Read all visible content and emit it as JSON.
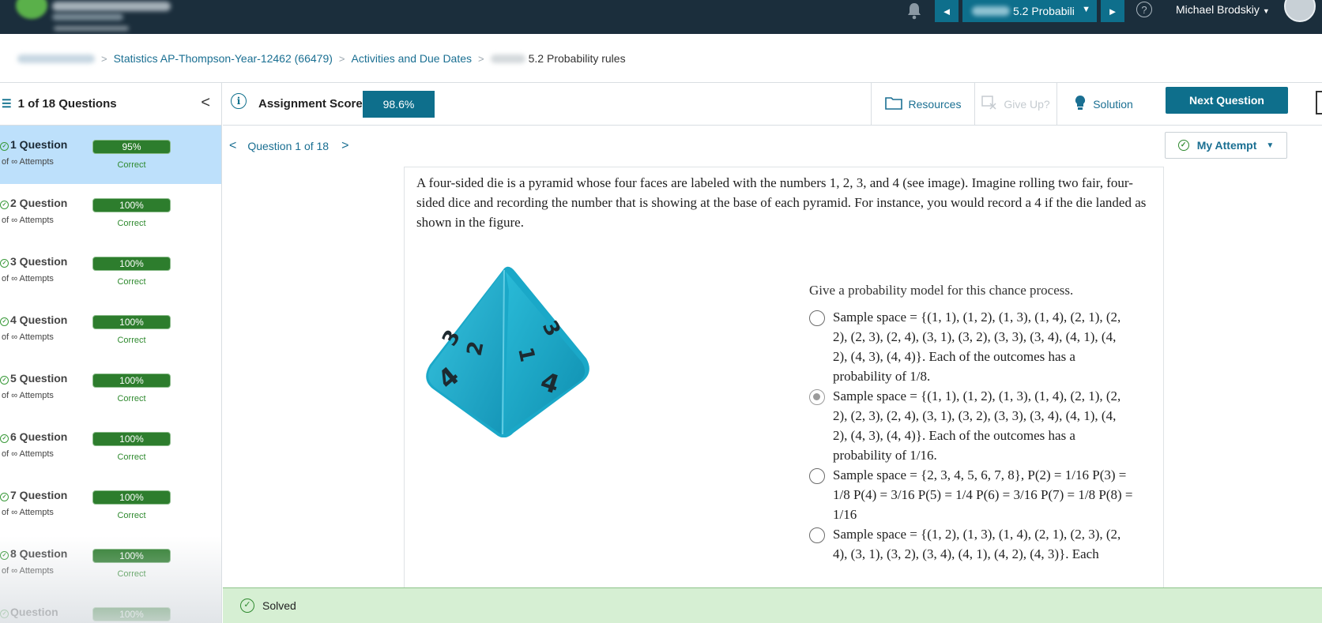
{
  "topbar": {
    "assignment_select": "5.2 Probabili",
    "prev_arrow": "◄",
    "next_arrow": "►",
    "select_caret": "▼",
    "help_label": "?",
    "user_name": "Michael Brodskiy",
    "user_caret": "▼"
  },
  "breadcrumb": {
    "course": "Statistics AP-Thompson-Year-12462 (66479)",
    "activities": "Activities and Due Dates",
    "current": "5.2 Probability rules",
    "separator": ">"
  },
  "sidebar": {
    "header": "1 of 18 Questions",
    "collapse": "<",
    "questions": [
      {
        "title": "1 Question",
        "attempts": "of ∞ Attempts",
        "score": "95%",
        "status": "Correct"
      },
      {
        "title": "2 Question",
        "attempts": "of ∞ Attempts",
        "score": "100%",
        "status": "Correct"
      },
      {
        "title": "3 Question",
        "attempts": "of ∞ Attempts",
        "score": "100%",
        "status": "Correct"
      },
      {
        "title": "4 Question",
        "attempts": "of ∞ Attempts",
        "score": "100%",
        "status": "Correct"
      },
      {
        "title": "5 Question",
        "attempts": "of ∞ Attempts",
        "score": "100%",
        "status": "Correct"
      },
      {
        "title": "6 Question",
        "attempts": "of ∞ Attempts",
        "score": "100%",
        "status": "Correct"
      },
      {
        "title": "7 Question",
        "attempts": "of ∞ Attempts",
        "score": "100%",
        "status": "Correct"
      },
      {
        "title": "8 Question",
        "attempts": "of ∞ Attempts",
        "score": "100%",
        "status": "Correct"
      },
      {
        "title": "Question",
        "attempts": "",
        "score": "100%",
        "status": ""
      }
    ]
  },
  "toolbar": {
    "score_label": "Assignment Score:",
    "score_value": "98.6%",
    "resources": "Resources",
    "give_up": "Give Up?",
    "solution": "Solution",
    "next_question": "Next Question"
  },
  "question_nav": {
    "label": "Question 1 of 18",
    "prev": "<",
    "next": ">",
    "my_attempt": "My Attempt",
    "my_attempt_caret": "▼"
  },
  "question": {
    "stem": "A four-sided die is a pyramid whose four faces are labeled with the numbers 1, 2, 3, and 4 (see image). Imagine rolling two fair, four-sided dice and recording the number that is showing at the base of each pyramid. For instance, you would record a 4 if the die landed as shown in the figure.",
    "prompt": "Give a probability model for this chance process.",
    "die_faces": [
      "3",
      "2",
      "1",
      "3",
      "4",
      "4"
    ],
    "options": [
      {
        "text": "Sample space = {(1, 1), (1, 2), (1, 3), (1, 4), (2, 1), (2, 2), (2, 3), (2, 4), (3, 1), (3, 2), (3, 3), (3, 4), (4, 1), (4, 2), (4, 3), (4, 4)}. Each of the outcomes has a probability of 1/8.",
        "selected": false
      },
      {
        "text": "Sample space = {(1, 1), (1, 2), (1, 3), (1, 4), (2, 1), (2, 2), (2, 3), (2, 4), (3, 1), (3, 2), (3, 3), (3, 4), (4, 1), (4, 2), (4, 3), (4, 4)}. Each of the outcomes has a probability of 1/16.",
        "selected": true
      },
      {
        "text": "Sample space = {2, 3, 4, 5, 6, 7, 8}, P(2) = 1/16 P(3) = 1/8 P(4) = 3/16 P(5) = 1/4 P(6) = 3/16 P(7) = 1/8 P(8) = 1/16",
        "selected": false
      },
      {
        "text": "Sample space = {(1, 2), (1, 3), (1, 4), (2, 1), (2, 3), (2, 4), (3, 1), (3, 2), (3, 4), (4, 1), (4, 2), (4, 3)}. Each",
        "selected": false
      }
    ]
  },
  "banner": {
    "status": "Solved",
    "check_glyph": "✓"
  },
  "colors": {
    "topbar_bg": "#1b2e3c",
    "accent": "#0e6f8c",
    "active_item": "#bde0fb",
    "success": "#2d7d2d",
    "solved_bg": "#d6efd3",
    "die": "#1fb3d2"
  }
}
